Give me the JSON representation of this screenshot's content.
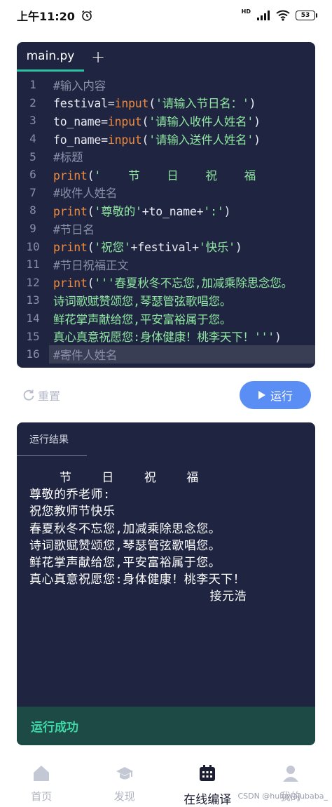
{
  "status": {
    "time": "上午11:20",
    "network": "HD",
    "battery": "53"
  },
  "editor": {
    "tab_label": "main.py",
    "add_label": "+",
    "lines": [
      {
        "n": "1",
        "segments": [
          {
            "t": "#输入内容",
            "c": "comment"
          }
        ]
      },
      {
        "n": "2",
        "segments": [
          {
            "t": "festival=",
            "c": "pl"
          },
          {
            "t": "input",
            "c": "kw"
          },
          {
            "t": "(",
            "c": "pl"
          },
          {
            "t": "'请输入节日名：'",
            "c": "str"
          },
          {
            "t": ")",
            "c": "pl"
          }
        ]
      },
      {
        "n": "3",
        "segments": [
          {
            "t": "to_name=",
            "c": "pl"
          },
          {
            "t": "input",
            "c": "kw"
          },
          {
            "t": "(",
            "c": "pl"
          },
          {
            "t": "'请输入收件人姓名'",
            "c": "str"
          },
          {
            "t": ")",
            "c": "pl"
          }
        ]
      },
      {
        "n": "4",
        "segments": [
          {
            "t": "fo_name=",
            "c": "pl"
          },
          {
            "t": "input",
            "c": "kw"
          },
          {
            "t": "(",
            "c": "pl"
          },
          {
            "t": "'请输入送件人姓名'",
            "c": "str"
          },
          {
            "t": ")",
            "c": "pl"
          }
        ]
      },
      {
        "n": "5",
        "segments": [
          {
            "t": "#标题",
            "c": "comment"
          }
        ]
      },
      {
        "n": "6",
        "segments": [
          {
            "t": "print",
            "c": "kw"
          },
          {
            "t": "(",
            "c": "pl"
          },
          {
            "t": "'    节    日    祝    福",
            "c": "str"
          }
        ]
      },
      {
        "n": "7",
        "segments": [
          {
            "t": "#收件人姓名",
            "c": "comment"
          }
        ]
      },
      {
        "n": "8",
        "segments": [
          {
            "t": "print",
            "c": "kw"
          },
          {
            "t": "(",
            "c": "pl"
          },
          {
            "t": "'尊敬的'",
            "c": "str"
          },
          {
            "t": "+to_name+",
            "c": "pl"
          },
          {
            "t": "':'",
            "c": "str"
          },
          {
            "t": ")",
            "c": "pl"
          }
        ]
      },
      {
        "n": "9",
        "segments": [
          {
            "t": "#节日名",
            "c": "comment"
          }
        ]
      },
      {
        "n": "10",
        "segments": [
          {
            "t": "print",
            "c": "kw"
          },
          {
            "t": "(",
            "c": "pl"
          },
          {
            "t": "'祝您'",
            "c": "str"
          },
          {
            "t": "+festival+",
            "c": "pl"
          },
          {
            "t": "'快乐'",
            "c": "str"
          },
          {
            "t": ")",
            "c": "pl"
          }
        ]
      },
      {
        "n": "11",
        "segments": [
          {
            "t": "#节日祝福正文",
            "c": "comment"
          }
        ]
      },
      {
        "n": "12",
        "segments": [
          {
            "t": "print",
            "c": "kw"
          },
          {
            "t": "(",
            "c": "pl"
          },
          {
            "t": "'''春夏秋冬不忘您,加减乘除思念您。",
            "c": "str"
          }
        ]
      },
      {
        "n": "13",
        "segments": [
          {
            "t": "诗词歌赋赞颂您,琴瑟管弦歌唱您。",
            "c": "str"
          }
        ]
      },
      {
        "n": "14",
        "segments": [
          {
            "t": "鲜花掌声献给您,平安富裕属于您。",
            "c": "str"
          }
        ]
      },
      {
        "n": "15",
        "segments": [
          {
            "t": "真心真意祝愿您:身体健康！桃李天下！'''",
            "c": "str"
          },
          {
            "t": ")",
            "c": "pl"
          }
        ]
      },
      {
        "n": "16",
        "segments": [
          {
            "t": "#寄件人姓名",
            "c": "comment"
          }
        ],
        "active": true
      }
    ]
  },
  "controls": {
    "reset_label": "重置",
    "run_label": "运行"
  },
  "output": {
    "title": "运行结果",
    "lines": [
      "    节    日    祝    福",
      "尊敬的乔老师:",
      "祝您教师节快乐",
      "春夏秋冬不忘您,加减乘除思念您。",
      "诗词歌赋赞颂您,琴瑟管弦歌唱您。",
      "鲜花掌声献给您,平安富裕属于您。",
      "真心真意祝愿您:身体健康！桃李天下！",
      "                        接元浩"
    ],
    "status": "运行成功"
  },
  "nav": {
    "items": [
      {
        "label": "首页",
        "icon": "home-icon"
      },
      {
        "label": "发现",
        "icon": "graduation-cap-icon"
      },
      {
        "label": "在线编译",
        "icon": "calendar-icon"
      },
      {
        "label": "我的",
        "icon": "user-icon"
      }
    ],
    "active_index": 2
  },
  "watermark": "CSDN @huluwajubaba_"
}
